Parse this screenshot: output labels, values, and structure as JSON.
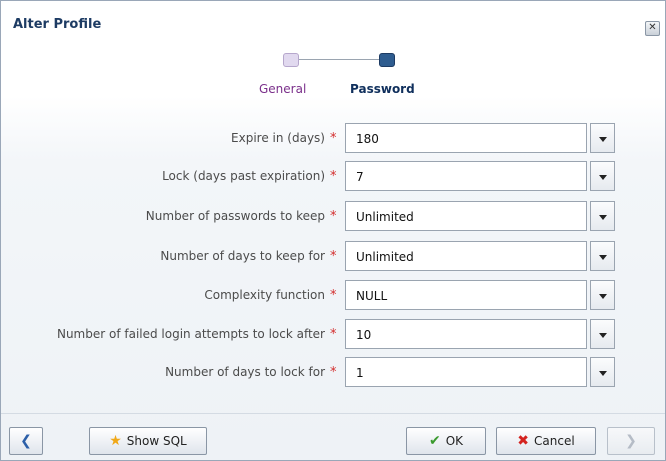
{
  "dialog": {
    "title": "Alter Profile",
    "close_icon": "close-icon"
  },
  "train": {
    "steps": [
      {
        "label": "General"
      },
      {
        "label": "Password"
      }
    ]
  },
  "form": {
    "rows": [
      {
        "label": "Expire in (days)",
        "value": "180"
      },
      {
        "label": "Lock (days past expiration)",
        "value": "7"
      },
      {
        "label": "Number of passwords to keep",
        "value": "Unlimited"
      },
      {
        "label": "Number of days to keep for",
        "value": "Unlimited"
      },
      {
        "label": "Complexity function",
        "value": "NULL"
      },
      {
        "label": "Number of failed login attempts to lock after",
        "value": "10"
      },
      {
        "label": "Number of days to lock for",
        "value": "1"
      }
    ],
    "required_mark": "*"
  },
  "footer": {
    "back_icon": "chevron-left-icon",
    "show_sql_label": "Show SQL",
    "ok_label": "OK",
    "cancel_label": "Cancel",
    "next_icon": "chevron-right-icon"
  },
  "colors": {
    "title": "#1d3b63",
    "required": "#d32c2c",
    "general_step": "#7a2f8a",
    "password_step": "#0f2f5c"
  }
}
